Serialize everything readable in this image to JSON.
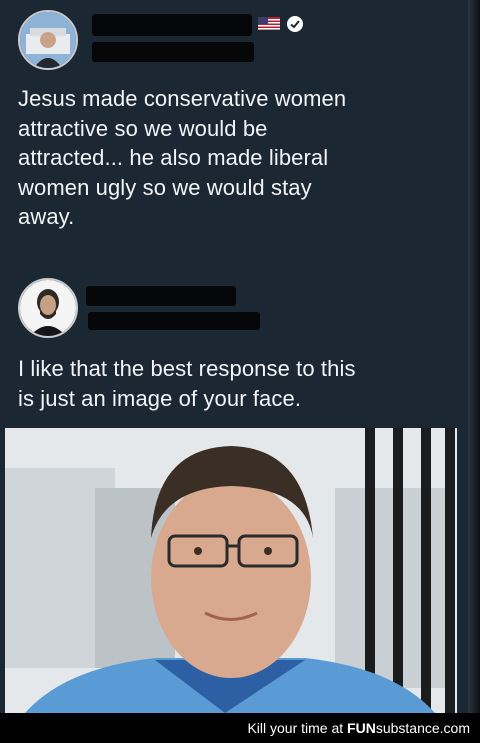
{
  "tweet1": {
    "text_lines": [
      "Jesus made conservative women",
      "attractive so we would be",
      "attracted... he also made liberal",
      "women ugly so we would stay",
      "away."
    ]
  },
  "tweet2": {
    "text_lines": [
      "I like that the best response to this",
      "is just an image of your face."
    ]
  },
  "footer": {
    "tagline": "Kill your time at",
    "brand_prefix": "FUN",
    "brand_suffix": "substance",
    "brand_tld": ".com"
  },
  "icons": [
    "flag-icon",
    "verified-badge-icon"
  ],
  "colors": {
    "background": "#1b2733",
    "text": "#f2f4f6",
    "footer": "#000000"
  }
}
